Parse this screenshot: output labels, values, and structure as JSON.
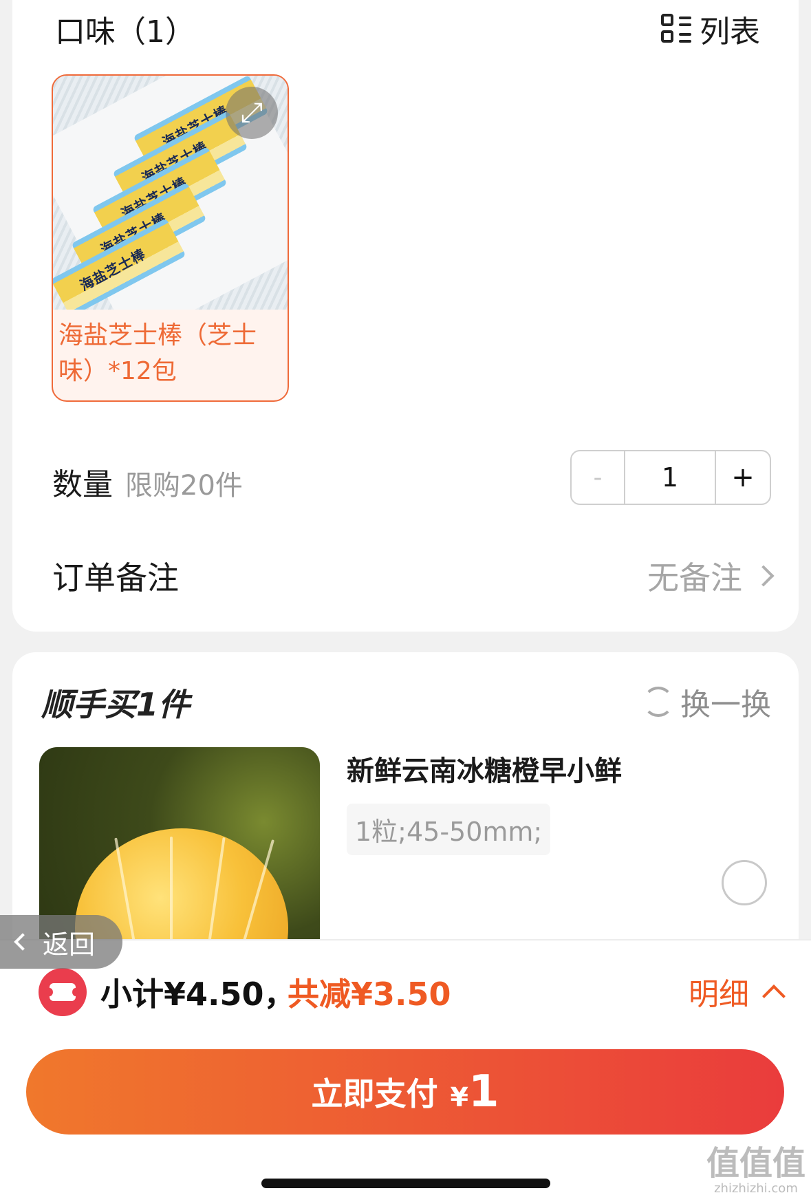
{
  "flavor": {
    "title": "口味（1）",
    "list_label": "列表",
    "option": {
      "label": "海盐芝士棒（芝士味）*12包",
      "package_text": "海盐芝士棒"
    }
  },
  "quantity": {
    "label": "数量",
    "limit": "限购20件",
    "minus": "-",
    "value": "1",
    "plus": "+"
  },
  "note": {
    "label": "订单备注",
    "value": "无备注"
  },
  "addon": {
    "title": "顺手买1件",
    "swap_label": "换一换",
    "product_name": "新鲜云南冰糖橙早小鲜",
    "spec": "1粒;45-50mm;"
  },
  "back": {
    "label": "返回"
  },
  "summary": {
    "subtotal": "小计¥4.50，",
    "discount": "共减¥3.50",
    "details_label": "明细"
  },
  "pay": {
    "label": "立即支付",
    "currency": "¥",
    "amount": "1"
  },
  "watermark": {
    "text": "值值值",
    "site": "zhizhizhi.com"
  },
  "colors": {
    "accent": "#ef5a23",
    "pay_gradient_start": "#f0782c",
    "pay_gradient_end": "#ea3c3c",
    "coupon": "#ea3d4d"
  }
}
